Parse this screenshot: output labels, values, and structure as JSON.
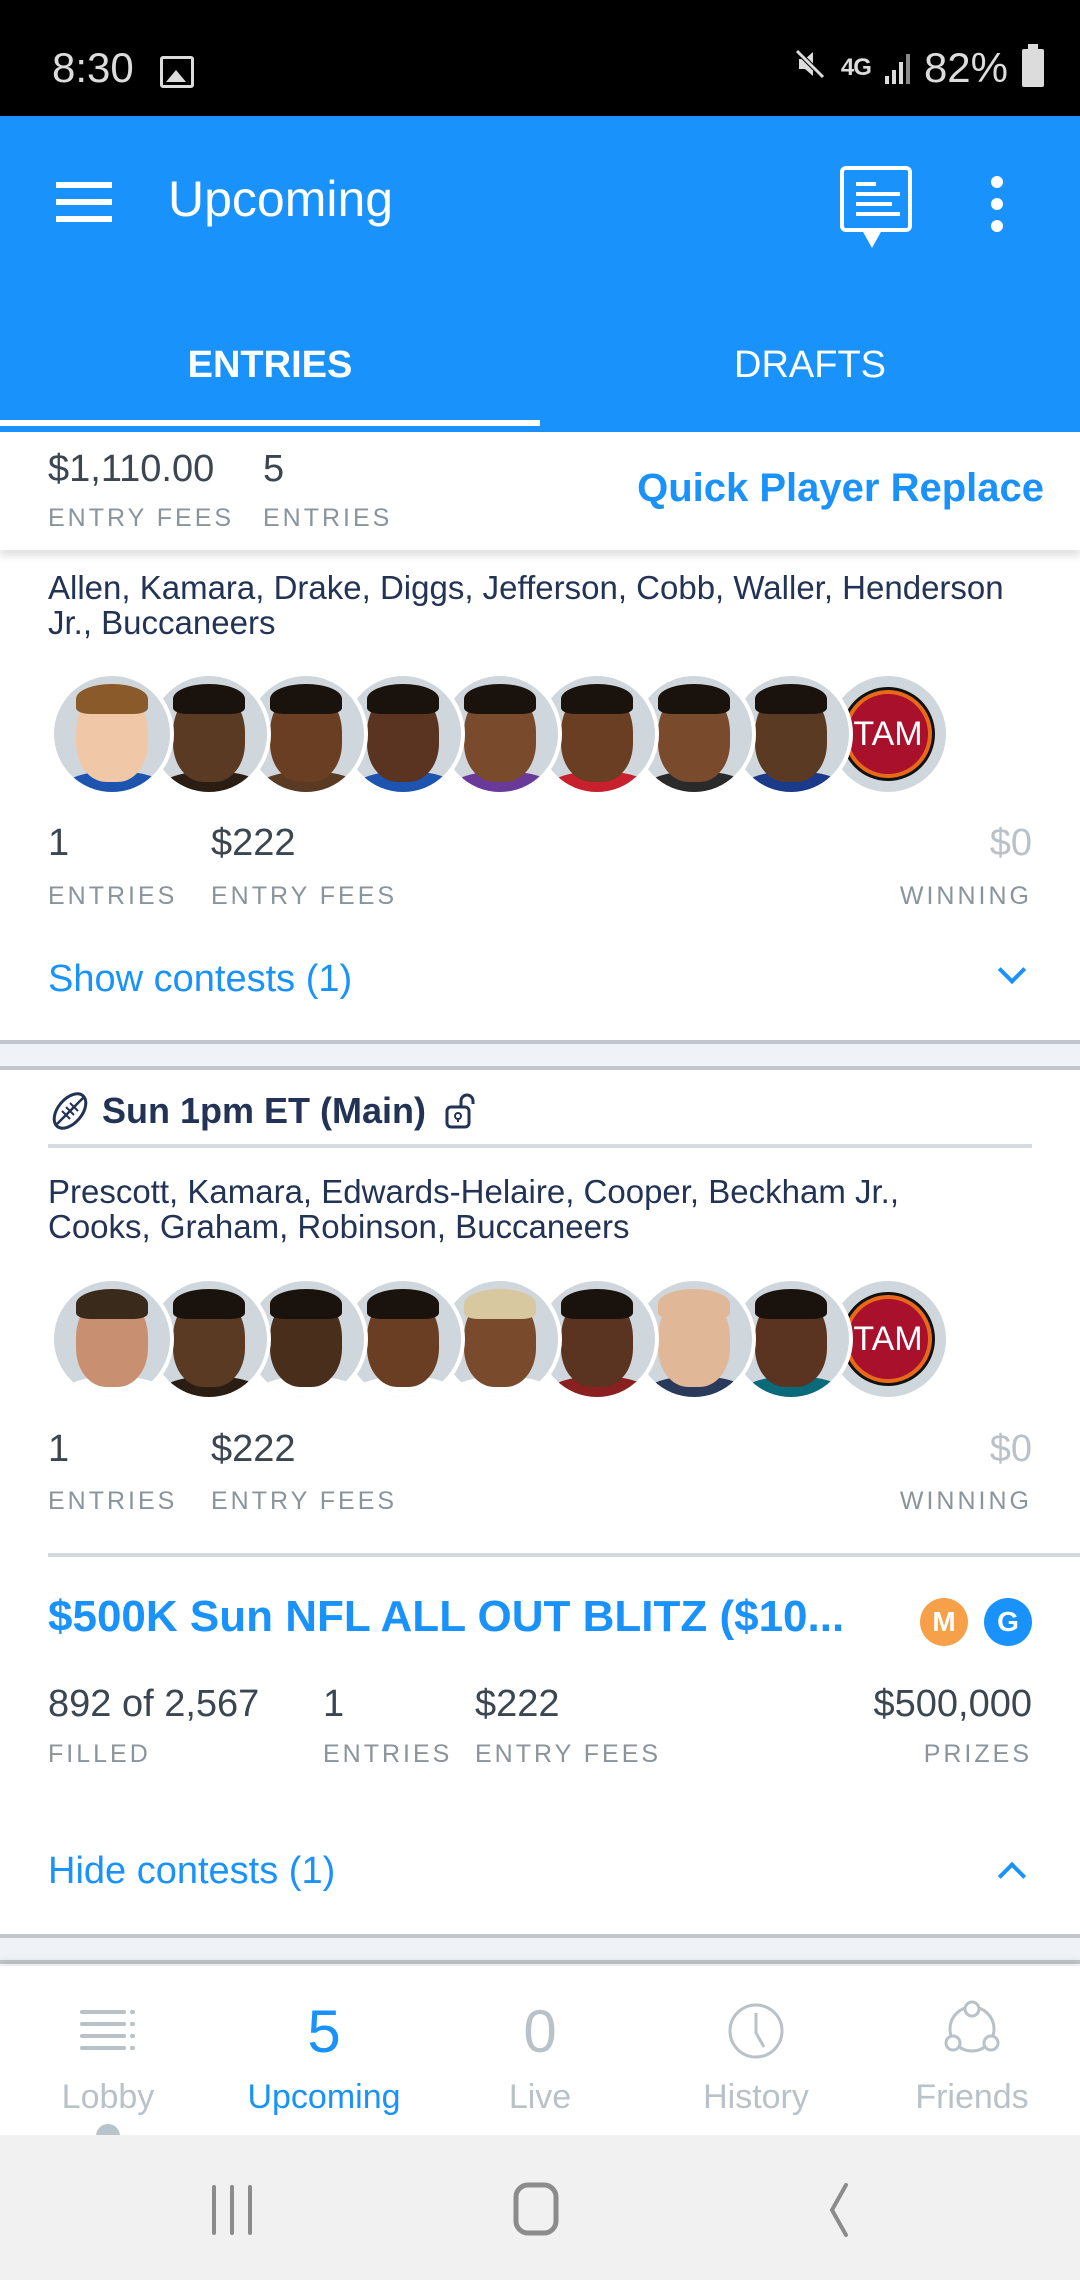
{
  "status_bar": {
    "time": "8:30",
    "network": "4G",
    "battery": "82%"
  },
  "app_bar": {
    "title": "Upcoming"
  },
  "tabs": [
    {
      "label": "ENTRIES",
      "active": true
    },
    {
      "label": "DRAFTS",
      "active": false
    }
  ],
  "summary": {
    "entry_fees_value": "$1,110.00",
    "entry_fees_label": "ENTRY FEES",
    "entries_value": "5",
    "entries_label": "ENTRIES",
    "quick_replace_label": "Quick Player Replace"
  },
  "lineups": [
    {
      "players_text": "Allen, Kamara, Drake, Diggs, Jefferson, Cobb, Waller, Henderson Jr., Buccaneers",
      "team_badge": "TAM",
      "entries_value": "1",
      "entries_label": "ENTRIES",
      "fees_value": "$222",
      "fees_label": "ENTRY FEES",
      "winning_value": "$0",
      "winning_label": "WINNING",
      "toggle_label": "Show contests (1)"
    },
    {
      "slate_title": "Sun 1pm ET (Main)",
      "players_text": "Prescott, Kamara, Edwards-Helaire, Cooper, Beckham Jr., Cooks, Graham, Robinson, Buccaneers",
      "team_badge": "TAM",
      "entries_value": "1",
      "entries_label": "ENTRIES",
      "fees_value": "$222",
      "fees_label": "ENTRY FEES",
      "winning_value": "$0",
      "winning_label": "WINNING",
      "contest": {
        "title": "$500K Sun NFL ALL OUT BLITZ ($10...",
        "badge_m": "M",
        "badge_g": "G",
        "filled_value": "892 of 2,567",
        "filled_label": "FILLED",
        "entries_value": "1",
        "entries_label": "ENTRIES",
        "fees_value": "$222",
        "fees_label": "ENTRY FEES",
        "prizes_value": "$500,000",
        "prizes_label": "PRIZES"
      },
      "toggle_label": "Hide contests (1)"
    }
  ],
  "bottom_nav": [
    {
      "label": "Lobby",
      "icon": "list-icon",
      "active": false
    },
    {
      "label": "Upcoming",
      "count": "5",
      "active": true
    },
    {
      "label": "Live",
      "count": "0",
      "active": false
    },
    {
      "label": "History",
      "icon": "clock-icon",
      "active": false
    },
    {
      "label": "Friends",
      "icon": "friends-icon",
      "active": false
    }
  ],
  "colors": {
    "brand_blue": "#1a92fb",
    "badge_m": "#f7a04a",
    "badge_g": "#1a92fb",
    "team_tam": "#a8102c"
  }
}
